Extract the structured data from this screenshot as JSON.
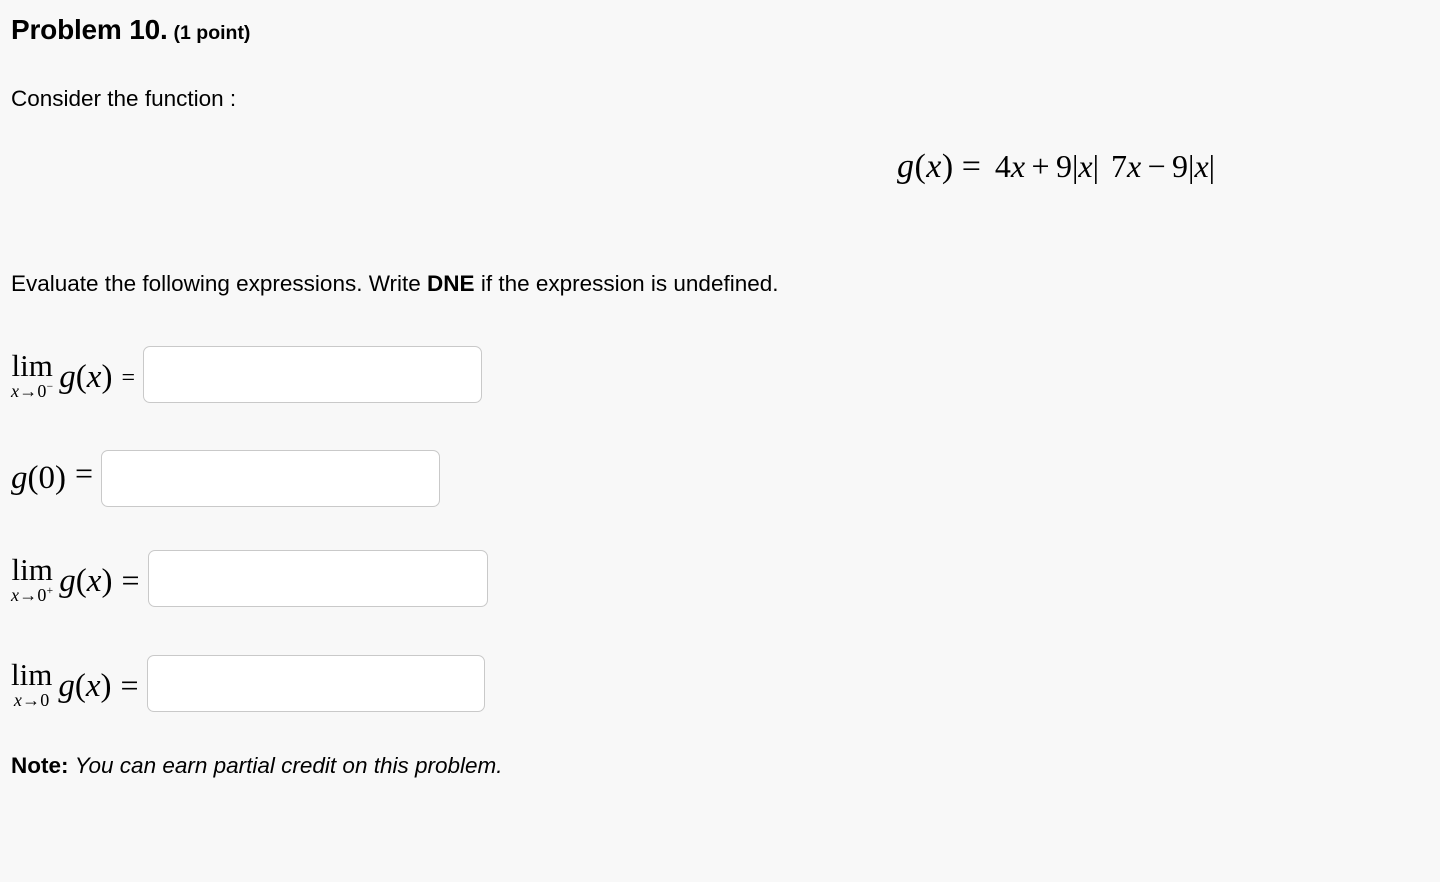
{
  "problem": {
    "title": "Problem 10.",
    "points": "(1 point)",
    "intro": "Consider the function :",
    "instructions_prefix": "Evaluate the following expressions. Write ",
    "instructions_emphasis": "DNE",
    "instructions_suffix": " if the expression is undefined."
  },
  "formula": {
    "function_name": "g",
    "lhs": "g(x)",
    "equals": "=",
    "numerator": "4x + 9|x|",
    "denominator": "7x − 9|x|",
    "numerator_parts": {
      "coef1": "4",
      "var1": "x",
      "op": "+",
      "coef2": "9",
      "bar_open": "|",
      "var2": "x",
      "bar_close": "|"
    },
    "denominator_parts": {
      "coef1": "7",
      "var1": "x",
      "op": "−",
      "coef2": "9",
      "bar_open": "|",
      "var2": "x",
      "bar_close": "|"
    }
  },
  "expressions": [
    {
      "id": "lim-left",
      "operator": "lim",
      "subscript_var": "x",
      "subscript_arrow": "→",
      "subscript_target": "0",
      "subscript_side": "−",
      "function": "g",
      "argument": "x",
      "equals": "=",
      "value": "",
      "placeholder": ""
    },
    {
      "id": "g-zero",
      "operator": "",
      "function": "g",
      "argument": "0",
      "equals": "=",
      "value": "",
      "placeholder": ""
    },
    {
      "id": "lim-right",
      "operator": "lim",
      "subscript_var": "x",
      "subscript_arrow": "→",
      "subscript_target": "0",
      "subscript_side": "+",
      "function": "g",
      "argument": "x",
      "equals": "=",
      "value": "",
      "placeholder": ""
    },
    {
      "id": "lim-two",
      "operator": "lim",
      "subscript_var": "x",
      "subscript_arrow": "→",
      "subscript_target": "0",
      "subscript_side": "",
      "function": "g",
      "argument": "x",
      "equals": "=",
      "value": "",
      "placeholder": ""
    }
  ],
  "note": {
    "label": "Note",
    "separator": ":",
    "text": "You can earn partial credit on this problem."
  },
  "colors": {
    "background": "#f8f8f8",
    "text": "#000000",
    "input_background": "#ffffff",
    "input_border": "#c9c9c9"
  }
}
